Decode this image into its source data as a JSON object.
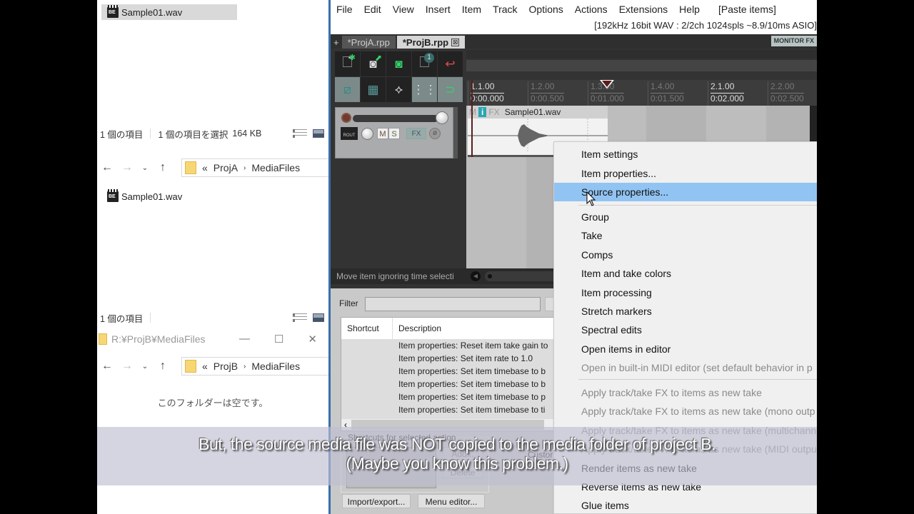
{
  "explorer_top": {
    "file": "Sample01.wav",
    "status_count": "1 個の項目",
    "status_selected": "1 個の項目を選択",
    "status_size": "164 KB"
  },
  "explorer_projA": {
    "path_prefix": "«",
    "path_parts": [
      "ProjA",
      "MediaFiles"
    ],
    "file": "Sample01.wav",
    "status_count": "1 個の項目"
  },
  "explorer_projB": {
    "title": "R:¥ProjB¥MediaFiles",
    "path_prefix": "«",
    "path_parts": [
      "ProjB",
      "MediaFiles"
    ],
    "empty_message": "このフォルダーは空です。",
    "controls": {
      "minimize": "—",
      "maximize": "☐",
      "close": "✕"
    }
  },
  "reaper": {
    "menu": [
      "File",
      "Edit",
      "View",
      "Insert",
      "Item",
      "Track",
      "Options",
      "Actions",
      "Extensions",
      "Help",
      "[Paste items]"
    ],
    "audio_info": "[192kHz 16bit WAV : 2/2ch 1024spls ~8.9/10ms ASIO]",
    "tabs": [
      {
        "label": "*ProjA.rpp",
        "active": false
      },
      {
        "label": "*ProjB.rpp",
        "active": true
      }
    ],
    "tab_add": "+",
    "tab_close": "⊠",
    "monitor_fx": "MONITOR FX",
    "toolbar": {
      "row1": [
        "new-project",
        "save-project",
        "save-copy",
        "project-info",
        "undo"
      ],
      "row2": [
        "ripple-edit",
        "grid-select",
        "envelope-points",
        "grid-toggle",
        "snap-toggle"
      ],
      "badge": "1"
    },
    "track": {
      "route_label": "ROUT",
      "mute": "M",
      "solo": "S",
      "fx": "FX",
      "phase": "ø"
    },
    "ruler": [
      {
        "bar": "1.1.00",
        "time": "0:00.000",
        "major": true
      },
      {
        "bar": "1.2.00",
        "time": "0:00.500",
        "major": false
      },
      {
        "bar": "1.3.00",
        "time": "0:01.000",
        "major": false
      },
      {
        "bar": "1.4.00",
        "time": "0:01.500",
        "major": false
      },
      {
        "bar": "2.1.00",
        "time": "0:02.000",
        "major": true
      },
      {
        "bar": "2.2.00",
        "time": "0:02.500",
        "major": false
      }
    ],
    "item": {
      "m": "M",
      "i": "i",
      "fx": "FX",
      "name": "Sample01.wav"
    },
    "status_message": "Move item ignoring time selecti",
    "actions": {
      "filter_label": "Filter",
      "filter_value": "",
      "col_shortcut": "Shortcut",
      "col_description": "Description",
      "rows": [
        "Item properties: Reset item take gain to",
        "Item properties: Set item rate to 1.0",
        "Item properties: Set item timebase to b",
        "Item properties: Set item timebase to b",
        "Item properties: Set item timebase to p",
        "Item properties: Set item timebase to ti"
      ],
      "shortcuts_label": "Shortcuts for selected action",
      "add": "Add...",
      "delete": "Delete",
      "custom": "Custor",
      "import_export": "Import/export...",
      "menu_editor": "Menu editor..."
    }
  },
  "context_menu": {
    "items": [
      {
        "label": "Item settings",
        "state": "normal"
      },
      {
        "label": "Item properties...",
        "state": "normal"
      },
      {
        "label": "Source properties...",
        "state": "highlighted"
      },
      {
        "label": "Group",
        "state": "normal"
      },
      {
        "label": "Take",
        "state": "normal"
      },
      {
        "label": "Comps",
        "state": "normal"
      },
      {
        "label": "Item and take colors",
        "state": "normal"
      },
      {
        "label": "Item processing",
        "state": "normal"
      },
      {
        "label": "Stretch markers",
        "state": "normal"
      },
      {
        "label": "Spectral edits",
        "state": "normal"
      },
      {
        "label": "Open items in editor",
        "state": "normal"
      },
      {
        "label": "Open in built-in MIDI editor (set default behavior in p",
        "state": "disabled"
      },
      {
        "label": "Apply track/take FX to items as new take",
        "state": "disabled"
      },
      {
        "label": "Apply track/take FX to items as new take (mono outp",
        "state": "disabled"
      },
      {
        "label": "Apply track/take FX to items as new take (multichann",
        "state": "disabled"
      },
      {
        "label": "Apply track/take FX to items as new take (MIDI outpu",
        "state": "disabled"
      },
      {
        "label": "Render items as new take",
        "state": "normal"
      },
      {
        "label": "Reverse items as new take",
        "state": "normal"
      },
      {
        "label": "Glue items",
        "state": "normal"
      }
    ]
  },
  "caption": {
    "line1": "But, the source media file was NOT copied to the media folder of project B.",
    "line2": "(Maybe you know this problem.)"
  }
}
